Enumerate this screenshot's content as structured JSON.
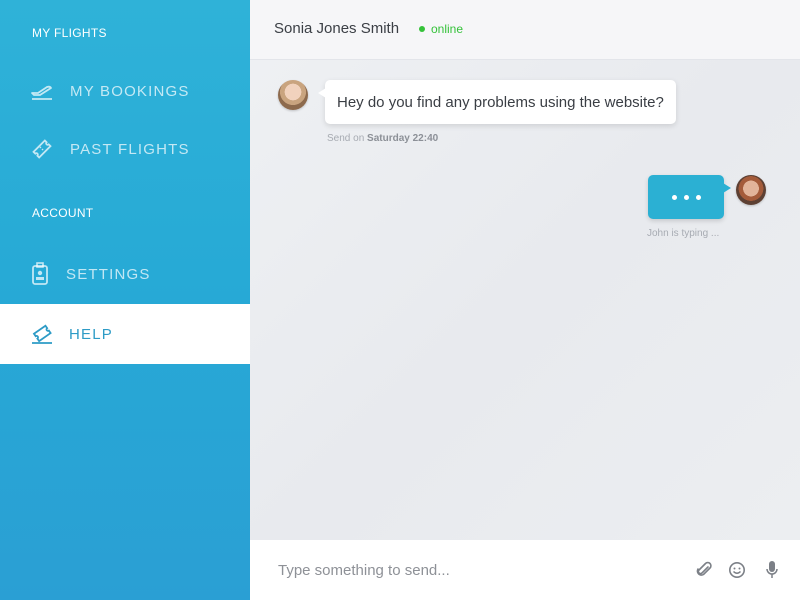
{
  "sidebar": {
    "section_flights": "MY FLIGHTS",
    "section_account": "ACCOUNT",
    "items": [
      {
        "label": "MY BOOKINGS",
        "icon": "plane-takeoff-icon"
      },
      {
        "label": "PAST FLIGHTS",
        "icon": "ticket-icon"
      },
      {
        "label": "SETTINGS",
        "icon": "id-badge-icon"
      },
      {
        "label": "HELP",
        "icon": "help-ticket-icon",
        "active": true
      }
    ]
  },
  "header": {
    "contact_name": "Sonia Jones Smith",
    "status": "online"
  },
  "messages": {
    "incoming_text": "Hey do you find any problems using the website?",
    "incoming_meta_prefix": "Send on",
    "incoming_meta_time": "Saturday 22:40",
    "typing_text": "John is typing ..."
  },
  "composer": {
    "placeholder": "Type something to send..."
  },
  "colors": {
    "accent": "#2bb0d3",
    "online": "#35c23a",
    "help_active": "#2d9bc6"
  }
}
